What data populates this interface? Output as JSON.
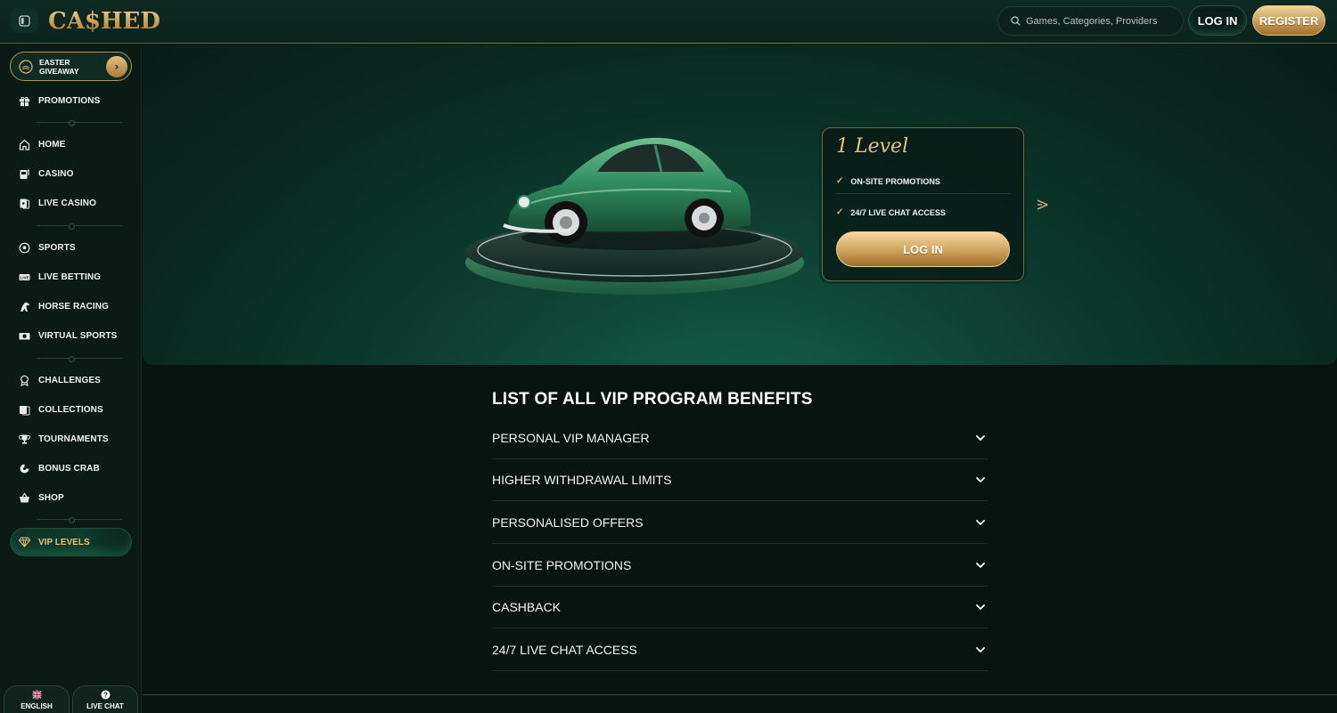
{
  "header": {
    "logo": "CA$HED",
    "search_placeholder": "Games, Categories, Providers",
    "login_label": "LOG IN",
    "register_label": "REGISTER"
  },
  "sidebar": {
    "promo": {
      "label": "EASTER GIVEAWAY"
    },
    "items": [
      {
        "label": "PROMOTIONS",
        "icon": "gift-icon"
      },
      {
        "label": "HOME",
        "icon": "home-icon"
      },
      {
        "label": "CASINO",
        "icon": "slot-machine-icon"
      },
      {
        "label": "LIVE CASINO",
        "icon": "cards-icon"
      },
      {
        "label": "SPORTS",
        "icon": "soccer-ball-icon"
      },
      {
        "label": "LIVE BETTING",
        "icon": "live-icon"
      },
      {
        "label": "HORSE RACING",
        "icon": "horse-icon"
      },
      {
        "label": "VIRTUAL SPORTS",
        "icon": "virtual-icon"
      },
      {
        "label": "CHALLENGES",
        "icon": "badge-icon"
      },
      {
        "label": "COLLECTIONS",
        "icon": "collection-icon"
      },
      {
        "label": "TOURNAMENTS",
        "icon": "trophy-icon"
      },
      {
        "label": "BONUS CRAB",
        "icon": "claw-icon"
      },
      {
        "label": "SHOP",
        "icon": "basket-icon"
      }
    ],
    "vip": {
      "label": "VIP LEVELS"
    },
    "language": "ENGLISH",
    "live_chat": "LIVE CHAT"
  },
  "hero": {
    "level_title": "1 Level",
    "benefits": [
      "ON-SITE PROMOTIONS",
      "24/7 LIVE CHAT ACCESS"
    ],
    "login_label": "LOG IN"
  },
  "benefits_list": {
    "title": "LIST OF ALL VIP PROGRAM BENEFITS",
    "items": [
      "PERSONAL VIP MANAGER",
      "HIGHER WITHDRAWAL LIMITS",
      "PERSONALISED OFFERS",
      "ON-SITE PROMOTIONS",
      "CASHBACK",
      "24/7 LIVE CHAT ACCESS"
    ]
  },
  "colors": {
    "gold": "#d8b272",
    "background": "#07140f",
    "panel": "#0a1a15"
  }
}
